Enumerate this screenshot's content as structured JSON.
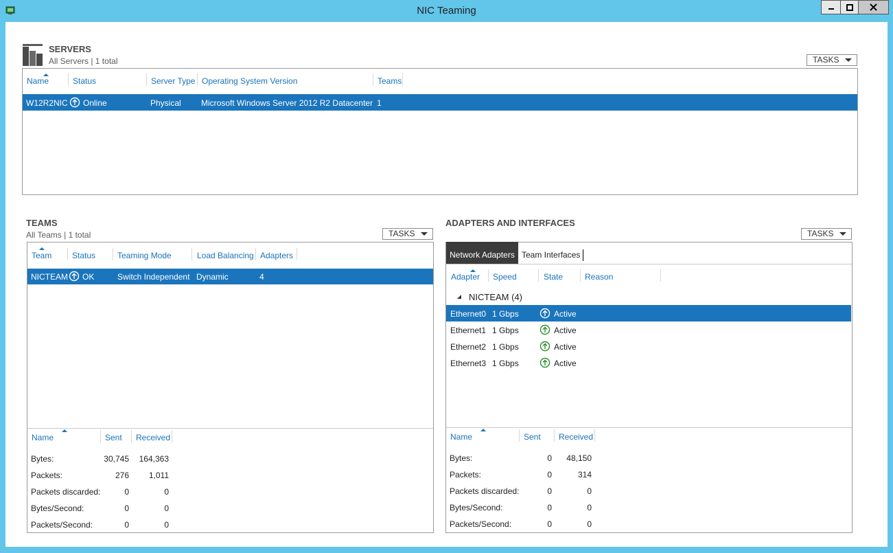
{
  "window": {
    "title": "NIC Teaming",
    "min_icon": "minimize-icon",
    "max_icon": "maximize-icon",
    "close_icon": "close-icon"
  },
  "servers": {
    "title": "SERVERS",
    "subtitle": "All Servers | 1 total",
    "tasks_label": "TASKS",
    "columns": [
      "Name",
      "Status",
      "Server Type",
      "Operating System Version",
      "Teams"
    ],
    "rows": [
      {
        "name": "W12R2NIC",
        "status": "Online",
        "server_type": "Physical",
        "os": "Microsoft Windows Server 2012 R2 Datacenter",
        "teams": "1"
      }
    ]
  },
  "teams": {
    "title": "TEAMS",
    "subtitle": "All Teams | 1 total",
    "tasks_label": "TASKS",
    "columns": [
      "Team",
      "Status",
      "Teaming Mode",
      "Load Balancing",
      "Adapters"
    ],
    "rows": [
      {
        "team": "NICTEAM",
        "status": "OK",
        "mode": "Switch Independent",
        "load_balancing": "Dynamic",
        "adapters": "4"
      }
    ],
    "stats_columns": [
      "Name",
      "Sent",
      "Received"
    ],
    "stats": [
      {
        "name": "Bytes:",
        "sent": "30,745",
        "received": "164,363"
      },
      {
        "name": "Packets:",
        "sent": "276",
        "received": "1,011"
      },
      {
        "name": "Packets discarded:",
        "sent": "0",
        "received": "0"
      },
      {
        "name": "Bytes/Second:",
        "sent": "0",
        "received": "0"
      },
      {
        "name": "Packets/Second:",
        "sent": "0",
        "received": "0"
      }
    ]
  },
  "adapters": {
    "title": "ADAPTERS AND INTERFACES",
    "tasks_label": "TASKS",
    "tabs": [
      "Network Adapters",
      "Team Interfaces"
    ],
    "columns": [
      "Adapter",
      "Speed",
      "State",
      "Reason"
    ],
    "group_label": "NICTEAM (4)",
    "rows": [
      {
        "adapter": "Ethernet0",
        "speed": "1 Gbps",
        "state": "Active"
      },
      {
        "adapter": "Ethernet1",
        "speed": "1 Gbps",
        "state": "Active"
      },
      {
        "adapter": "Ethernet2",
        "speed": "1 Gbps",
        "state": "Active"
      },
      {
        "adapter": "Ethernet3",
        "speed": "1 Gbps",
        "state": "Active"
      }
    ],
    "stats_columns": [
      "Name",
      "Sent",
      "Received"
    ],
    "stats": [
      {
        "name": "Bytes:",
        "sent": "0",
        "received": "48,150"
      },
      {
        "name": "Packets:",
        "sent": "0",
        "received": "314"
      },
      {
        "name": "Packets discarded:",
        "sent": "0",
        "received": "0"
      },
      {
        "name": "Bytes/Second:",
        "sent": "0",
        "received": "0"
      },
      {
        "name": "Packets/Second:",
        "sent": "0",
        "received": "0"
      }
    ]
  },
  "colors": {
    "accent": "#1b75bc",
    "header_text": "#1a73b8",
    "frame": "#62c5ea",
    "status_ok": "#2e8b2e"
  }
}
